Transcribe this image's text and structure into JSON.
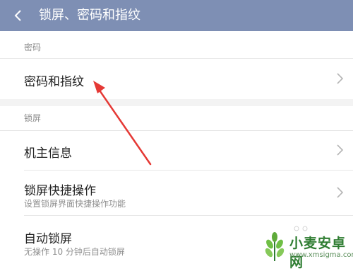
{
  "header": {
    "title": "锁屏、密码和指纹",
    "back_icon": "back-arrow-icon"
  },
  "sections": [
    {
      "label": "密码",
      "items": [
        {
          "title": "密码和指纹",
          "subtitle": ""
        }
      ]
    },
    {
      "label": "锁屏",
      "items": [
        {
          "title": "机主信息",
          "subtitle": ""
        },
        {
          "title": "锁屏快捷操作",
          "subtitle": "设置锁屏界面快捷操作功能"
        },
        {
          "title": "自动锁屏",
          "subtitle": "无操作 10 分钟后自动锁屏"
        }
      ]
    }
  ],
  "watermark": {
    "brand": "小麦安卓网",
    "url": "www.xmsigma.com"
  },
  "colors": {
    "header_bg": "#7e8fb4",
    "annotation_arrow": "#e53935",
    "watermark_green": "#2f7d32"
  }
}
